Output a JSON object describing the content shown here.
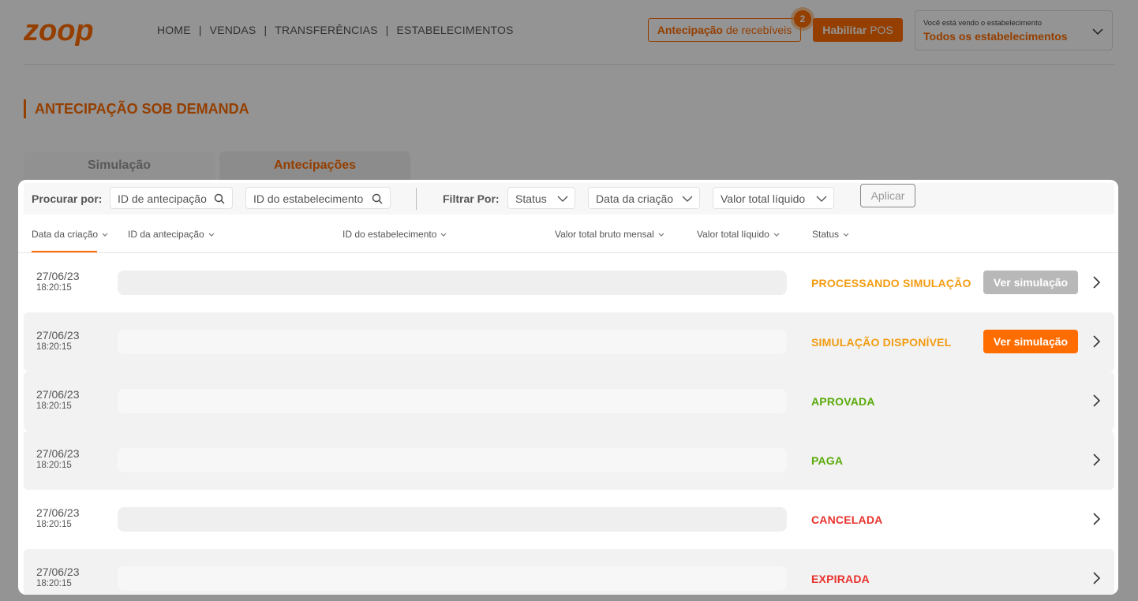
{
  "header": {
    "logo_text": "zoop",
    "nav": [
      "HOME",
      "VENDAS",
      "TRANSFERÊNCIAS",
      "ESTABELECIMENTOS"
    ],
    "antecipacao_button": {
      "bold": "Antecipação",
      "rest": "de recebíveis"
    },
    "notification_count": "2",
    "pos_button": {
      "bold": "Habilitar",
      "rest": "POS"
    },
    "establishment": {
      "caption": "Você está vendo o estabelecimento",
      "value": "Todos os estabelecimentos"
    }
  },
  "page_title": "ANTECIPAÇÃO SOB DEMANDA",
  "tabs": [
    {
      "label": "Simulação",
      "active": false
    },
    {
      "label": "Antecipações",
      "active": true
    }
  ],
  "filters": {
    "search_label": "Procurar por:",
    "search_antecipacao_placeholder": "ID de antecipação",
    "search_estab_placeholder": "ID do estabelecimento",
    "filter_label": "Filtrar Por:",
    "dropdowns": [
      "Status",
      "Data da criação",
      "Valor total líquido"
    ],
    "apply_label": "Aplicar"
  },
  "columns": [
    "Data da criação",
    "ID da antecipação",
    "ID do estabelecimento",
    "Valor total bruto mensal",
    "Valor total líquido",
    "Status"
  ],
  "rows": [
    {
      "date": "27/06/23",
      "time": "18:20:15",
      "status": "PROCESSANDO SIMULAÇÃO",
      "status_color": "#f39c12",
      "button": "Ver simulação",
      "button_color": "#b8b8b8"
    },
    {
      "date": "27/06/23",
      "time": "18:20:15",
      "status": "SIMULAÇÃO DISPONÍVEL",
      "status_color": "#f39c12",
      "button": "Ver simulação",
      "button_color": "#ff6c00"
    },
    {
      "date": "27/06/23",
      "time": "18:20:15",
      "status": "APROVADA",
      "status_color": "#5aaa0a",
      "button": "",
      "button_color": ""
    },
    {
      "date": "27/06/23",
      "time": "18:20:15",
      "status": "PAGA",
      "status_color": "#5aaa0a",
      "button": "",
      "button_color": ""
    },
    {
      "date": "27/06/23",
      "time": "18:20:15",
      "status": "CANCELADA",
      "status_color": "#e8322e",
      "button": "",
      "button_color": ""
    },
    {
      "date": "27/06/23",
      "time": "18:20:15",
      "status": "EXPIRADA",
      "status_color": "#e8322e",
      "button": "",
      "button_color": ""
    }
  ],
  "colors": {
    "brand": "#ff6c00"
  }
}
